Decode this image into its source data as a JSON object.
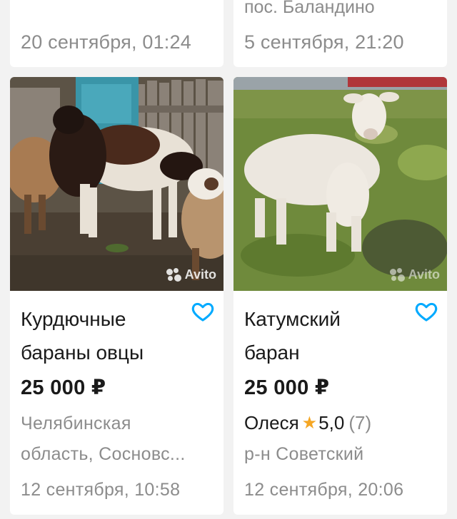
{
  "top_cards": [
    {
      "location": "",
      "date": "20 сентября, 01:24"
    },
    {
      "location": "пос. Баландино",
      "date": "5 сентября, 21:20"
    }
  ],
  "listings": [
    {
      "title_line1": "Курдючные",
      "title_line2": "бараны овцы",
      "price": "25 000 ₽",
      "location_line1": "Челябинская",
      "location_line2": "область, Сосновс...",
      "date": "12 сентября, 10:58",
      "watermark": "Avito",
      "favorite_icon": "heart-outline-icon"
    },
    {
      "title_line1": "Катумский",
      "title_line2": "баран",
      "price": "25 000 ₽",
      "seller_name": "Олеся",
      "seller_rating": "5,0",
      "seller_reviews": "(7)",
      "location": "р-н Советский",
      "date": "12 сентября, 20:06",
      "watermark": "Avito",
      "favorite_icon": "heart-outline-icon"
    }
  ],
  "colors": {
    "accent": "#00aaff",
    "muted_text": "#8c8c8c",
    "rating_star": "#f5a623",
    "background": "#f2f2f2"
  }
}
